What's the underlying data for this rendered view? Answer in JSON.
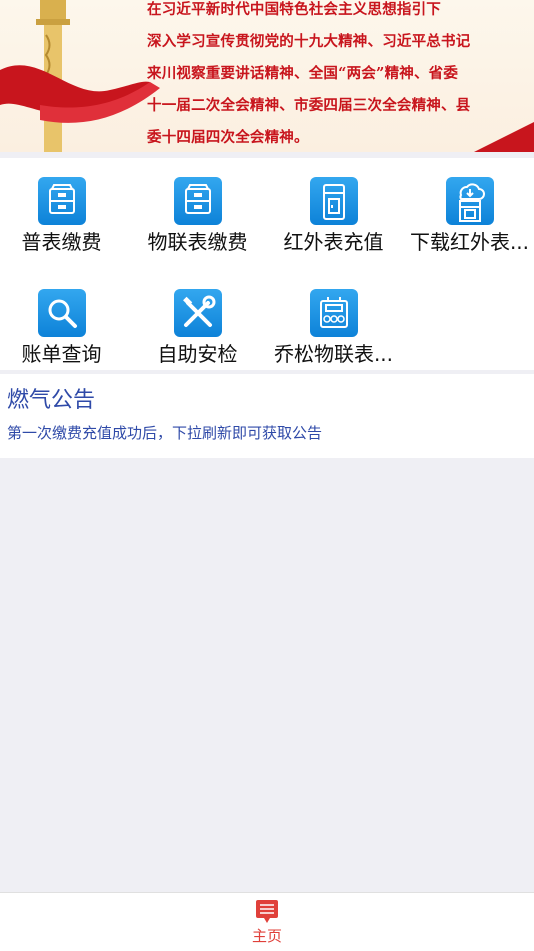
{
  "banner": {
    "lines": [
      "在习近平新时代中国特色社会主义思想指引下",
      "深入学习宣传贯彻党的十九大精神、习近平总书记",
      "来川视察重要讲话精神、全国“两会”精神、省委",
      "十一届二次全会精神、市委四届三次全会精神、县",
      "委十四届四次全会精神。"
    ]
  },
  "services": [
    {
      "label": "普表缴费",
      "icon": "cabinet-icon"
    },
    {
      "label": "物联表缴费",
      "icon": "cabinet-icon"
    },
    {
      "label": "红外表充值",
      "icon": "meter-icon"
    },
    {
      "label": "下载红外表...",
      "icon": "cloud-download-icon"
    },
    {
      "label": "账单查询",
      "icon": "search-icon"
    },
    {
      "label": "自助安检",
      "icon": "tools-icon"
    },
    {
      "label": "乔松物联表...",
      "icon": "gas-meter-icon"
    }
  ],
  "notice": {
    "title": "燃气公告",
    "text": "第一次缴费充值成功后，下拉刷新即可获取公告"
  },
  "tabbar": {
    "home_label": "主页",
    "active_color": "#e0403a"
  },
  "colors": {
    "tile_blue": "#1a8fe0",
    "notice_text": "#2f4aa8",
    "banner_red": "#c8151d"
  }
}
